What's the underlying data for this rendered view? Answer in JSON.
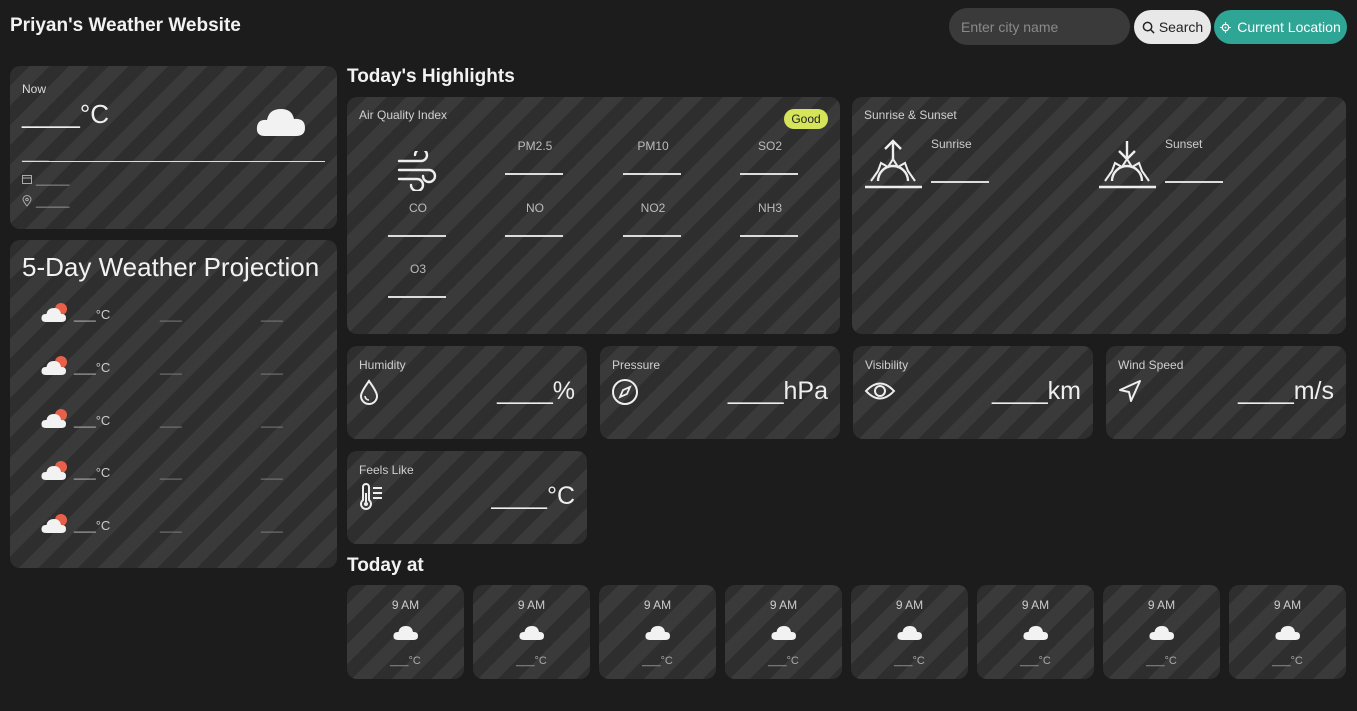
{
  "header": {
    "title": "Priyan's Weather Website",
    "search_placeholder": "Enter city name",
    "search_label": "Search",
    "location_label": "Current Location"
  },
  "now": {
    "label": "Now",
    "temp": "____°C",
    "desc": "____",
    "date": "_____",
    "place": "_____"
  },
  "forecast": {
    "title": "5-Day Weather Projection",
    "rows": [
      {
        "temp": "___°C",
        "d1": "___",
        "d2": "___"
      },
      {
        "temp": "___°C",
        "d1": "___",
        "d2": "___"
      },
      {
        "temp": "___°C",
        "d1": "___",
        "d2": "___"
      },
      {
        "temp": "___°C",
        "d1": "___",
        "d2": "___"
      },
      {
        "temp": "___°C",
        "d1": "___",
        "d2": "___"
      }
    ]
  },
  "highlights": {
    "title": "Today's Highlights",
    "aqi": {
      "label": "Air Quality Index",
      "badge": "Good",
      "pollutants": [
        "PM2.5",
        "PM10",
        "SO2",
        "CO",
        "NO",
        "NO2",
        "NH3",
        "O3"
      ]
    },
    "sun": {
      "label": "Sunrise & Sunset",
      "sunrise": "Sunrise",
      "sunset": "Sunset"
    },
    "humidity": {
      "label": "Humidity",
      "value": "____%"
    },
    "pressure": {
      "label": "Pressure",
      "value": "____hPa"
    },
    "visibility": {
      "label": "Visibility",
      "value": "____km"
    },
    "wind": {
      "label": "Wind Speed",
      "value": "____m/s"
    },
    "feels": {
      "label": "Feels Like",
      "value": "____°C"
    }
  },
  "today": {
    "title": "Today at",
    "hours": [
      {
        "time": "9 AM",
        "temp": "___°C"
      },
      {
        "time": "9 AM",
        "temp": "___°C"
      },
      {
        "time": "9 AM",
        "temp": "___°C"
      },
      {
        "time": "9 AM",
        "temp": "___°C"
      },
      {
        "time": "9 AM",
        "temp": "___°C"
      },
      {
        "time": "9 AM",
        "temp": "___°C"
      },
      {
        "time": "9 AM",
        "temp": "___°C"
      },
      {
        "time": "9 AM",
        "temp": "___°C"
      }
    ]
  },
  "colors": {
    "background": "#1c1c1c",
    "card": "#353535",
    "accent": "#2fa596",
    "badge": "#d6e45a"
  }
}
